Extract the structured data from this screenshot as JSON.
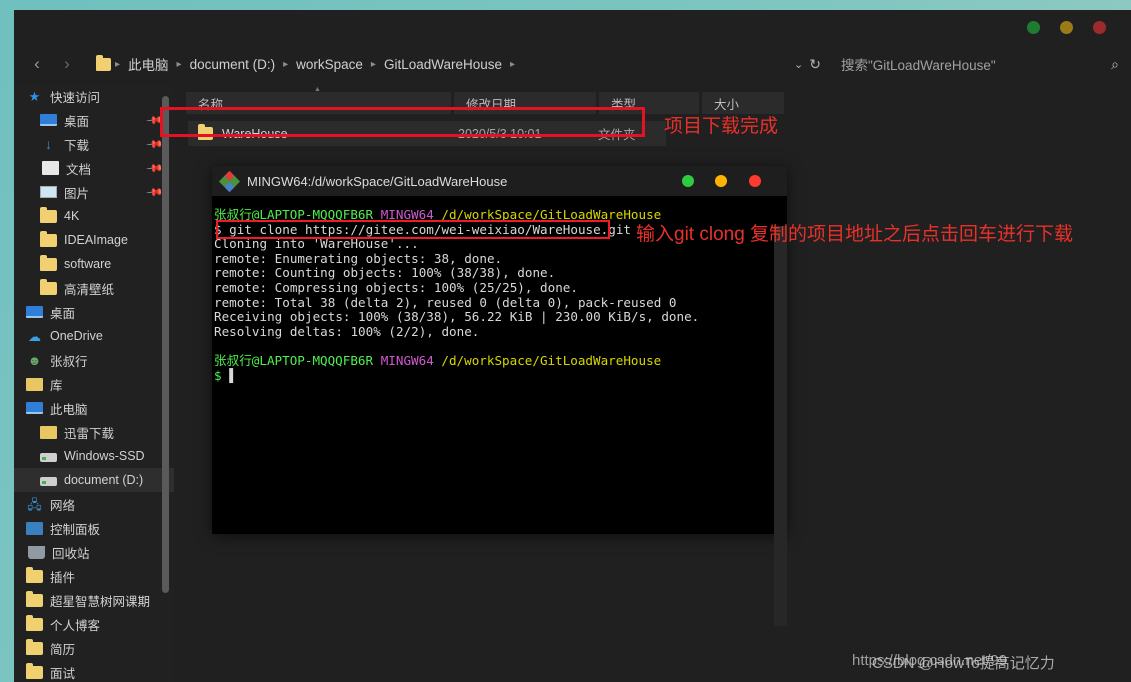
{
  "window": {
    "controls": {
      "minimize": "●",
      "maximize": "●",
      "close": "●"
    }
  },
  "nav": {
    "back": "‹",
    "forward": "›",
    "breadcrumb": [
      "此电脑",
      "document (D:)",
      "workSpace",
      "GitLoadWareHouse"
    ],
    "separator": "▸",
    "chevron_down": "⌄",
    "refresh": "↻",
    "search_placeholder": "搜索\"GitLoadWareHouse\"",
    "search_icon": "⌕"
  },
  "sidebar": {
    "scrollbar": true,
    "items": [
      {
        "label": "快速访问",
        "icon": "star-icon",
        "indent": 0,
        "pinned": false,
        "selected": false
      },
      {
        "label": "桌面",
        "icon": "monitor-icon",
        "indent": 1,
        "pinned": true,
        "selected": false
      },
      {
        "label": "下载",
        "icon": "download-icon",
        "indent": 1,
        "pinned": true,
        "selected": false
      },
      {
        "label": "文档",
        "icon": "document-icon",
        "indent": 1,
        "pinned": true,
        "selected": false
      },
      {
        "label": "图片",
        "icon": "picture-icon",
        "indent": 1,
        "pinned": true,
        "selected": false
      },
      {
        "label": "4K",
        "icon": "folder-icon",
        "indent": 1,
        "pinned": false,
        "selected": false
      },
      {
        "label": "IDEAImage",
        "icon": "folder-icon",
        "indent": 1,
        "pinned": false,
        "selected": false
      },
      {
        "label": "software",
        "icon": "folder-icon",
        "indent": 1,
        "pinned": false,
        "selected": false
      },
      {
        "label": "高清壁纸",
        "icon": "folder-icon",
        "indent": 1,
        "pinned": false,
        "selected": false
      },
      {
        "label": "桌面",
        "icon": "monitor-icon",
        "indent": 0,
        "pinned": false,
        "selected": false
      },
      {
        "label": "OneDrive",
        "icon": "cloud-icon",
        "indent": 0,
        "pinned": false,
        "selected": false
      },
      {
        "label": "张叔行",
        "icon": "user-icon",
        "indent": 0,
        "pinned": false,
        "selected": false
      },
      {
        "label": "库",
        "icon": "library-icon",
        "indent": 0,
        "pinned": false,
        "selected": false
      },
      {
        "label": "此电脑",
        "icon": "monitor-icon",
        "indent": 0,
        "pinned": false,
        "selected": false
      },
      {
        "label": "迅雷下载",
        "icon": "thunder-folder-icon",
        "indent": 1,
        "pinned": false,
        "selected": false
      },
      {
        "label": "Windows-SSD",
        "icon": "drive-icon",
        "indent": 1,
        "pinned": false,
        "selected": false
      },
      {
        "label": "document (D:)",
        "icon": "drive-icon",
        "indent": 1,
        "pinned": false,
        "selected": true
      },
      {
        "label": "网络",
        "icon": "network-icon",
        "indent": 0,
        "pinned": false,
        "selected": false
      },
      {
        "label": "控制面板",
        "icon": "control-panel-icon",
        "indent": 0,
        "pinned": false,
        "selected": false
      },
      {
        "label": "回收站",
        "icon": "recycle-bin-icon",
        "indent": 0,
        "pinned": false,
        "selected": false
      },
      {
        "label": "插件",
        "icon": "folder-icon",
        "indent": 0,
        "pinned": false,
        "selected": false
      },
      {
        "label": "超星智慧树网课期",
        "icon": "folder-icon",
        "indent": 0,
        "pinned": false,
        "selected": false
      },
      {
        "label": "个人博客",
        "icon": "folder-icon",
        "indent": 0,
        "pinned": false,
        "selected": false
      },
      {
        "label": "简历",
        "icon": "folder-icon",
        "indent": 0,
        "pinned": false,
        "selected": false
      },
      {
        "label": "面试",
        "icon": "folder-icon",
        "indent": 0,
        "pinned": false,
        "selected": false
      }
    ],
    "pin_glyph": "📌"
  },
  "filelist": {
    "columns": [
      "名称",
      "修改日期",
      "类型",
      "大小"
    ],
    "rows": [
      {
        "name": "WareHouse",
        "date": "2020/5/3 10:01",
        "type": "文件夹",
        "size": ""
      }
    ]
  },
  "annotations": {
    "file_done": "项目下载完成",
    "command_hint": "输入git clong 复制的项目地址之后点击回车进行下载",
    "accent_red": "#e8312a"
  },
  "terminal": {
    "title": "MINGW64:/d/workSpace/GitLoadWareHouse",
    "icon": "git-bash-icon",
    "controls": {
      "minimize": "●",
      "maximize": "●",
      "close": "●"
    },
    "prompt_user": "张叔行@LAPTOP-MQQQFB6R",
    "prompt_shell": "MINGW64",
    "prompt_path": "/d/workSpace/GitLoadWareHouse",
    "command": "git clone https://gitee.com/wei-weixiao/WareHouse.git",
    "dollar": "$",
    "output": [
      "Cloning into 'WareHouse'...",
      "remote: Enumerating objects: 38, done.",
      "remote: Counting objects: 100% (38/38), done.",
      "remote: Compressing objects: 100% (25/25), done.",
      "remote: Total 38 (delta 2), reused 0 (delta 0), pack-reused 0",
      "Receiving objects: 100% (38/38), 56.22 KiB | 230.00 KiB/s, done.",
      "Resolving deltas: 100% (2/2), done."
    ],
    "cursor": "▌",
    "colors": {
      "green": "#4ef04e",
      "magenta": "#d05ad0",
      "yellow": "#d7d700",
      "white": "#d8d8d8"
    }
  },
  "watermarks": {
    "line_a": "https://blog.csdn.net/99",
    "line_b": "CSDN @HowTo提高记忆力"
  }
}
